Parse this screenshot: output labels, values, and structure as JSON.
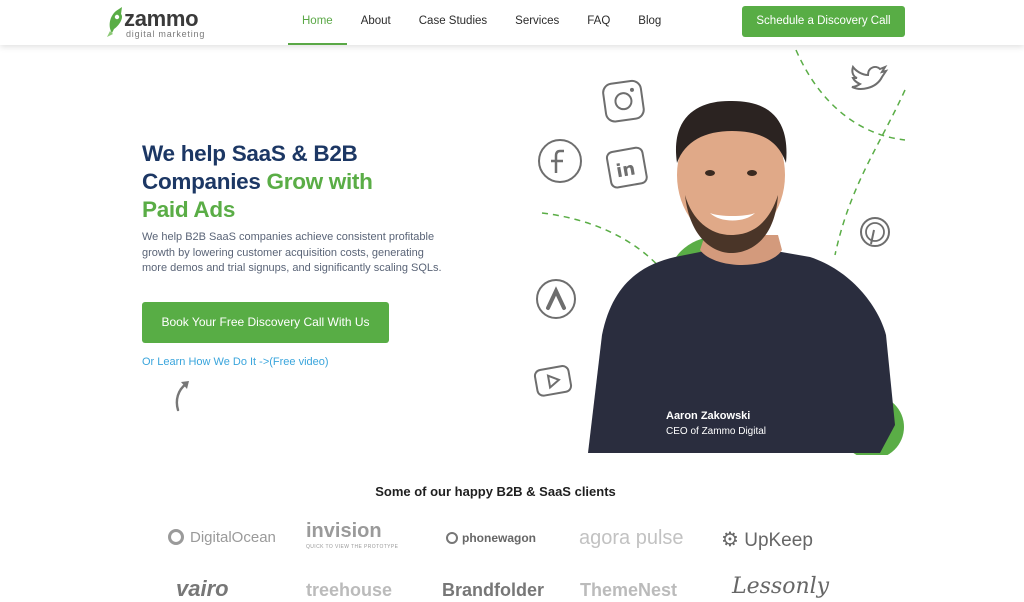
{
  "header": {
    "logo_text": "zammo",
    "logo_sub": "digital marketing",
    "nav": [
      {
        "label": "Home",
        "active": true
      },
      {
        "label": "About"
      },
      {
        "label": "Case Studies"
      },
      {
        "label": "Services"
      },
      {
        "label": "FAQ"
      },
      {
        "label": "Blog"
      }
    ],
    "cta": "Schedule a Discovery Call"
  },
  "hero": {
    "title_line1": "We help SaaS & B2B",
    "title_line2_a": "Companies ",
    "title_line2_b": "Grow with",
    "title_line3": "Paid Ads",
    "description": "We help B2B SaaS companies achieve consistent profitable growth by lowering customer acquisition costs, generating more demos and trial signups, and significantly scaling SQLs.",
    "cta": "Book Your Free Discovery Call With Us",
    "link": "Or Learn How We Do It ->(Free video)",
    "person_name": "Aaron Zakowski",
    "person_role": "CEO of Zammo Digital"
  },
  "clients": {
    "title": "Some of our happy B2B & SaaS clients",
    "row1": [
      "DigitalOcean",
      "invision",
      "QUICK TO VIEW THE PROTOTYPE",
      "phonewagon",
      "agora pulse",
      "UpKeep"
    ],
    "row2": [
      "vairo",
      "treehouse",
      "Brandfolder",
      "ThemeNest",
      "Lessonly"
    ]
  },
  "icons": [
    "instagram-icon",
    "twitter-icon",
    "facebook-icon",
    "linkedin-icon",
    "pinterest-icon",
    "google-ads-icon",
    "youtube-icon"
  ],
  "colors": {
    "brand_green": "#58ad45",
    "navy": "#1c3764",
    "link_blue": "#3aa5dc"
  }
}
